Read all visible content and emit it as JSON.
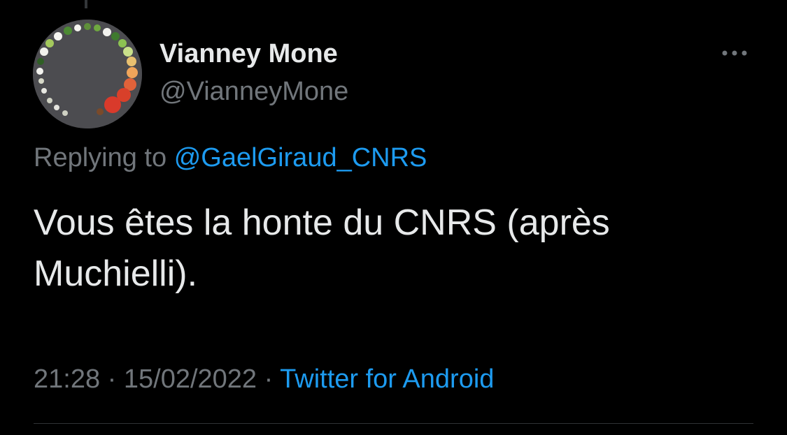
{
  "tweet": {
    "author": {
      "display_name": "Vianney Mone",
      "handle": "@VianneyMone"
    },
    "replying_to": {
      "prefix": "Replying to",
      "mention": "@GaelGiraud_CNRS"
    },
    "text": "Vous êtes la honte du CNRS (après Muchielli).",
    "meta": {
      "time": "21:28",
      "separator": "·",
      "date": "15/02/2022",
      "source": "Twitter for Android"
    },
    "more_icon": "more-horizontal-icon"
  },
  "colors": {
    "background": "#000000",
    "primary_text": "#e7e9ea",
    "secondary_text": "#71767b",
    "accent": "#1d9bf0",
    "divider": "#2f3336"
  }
}
